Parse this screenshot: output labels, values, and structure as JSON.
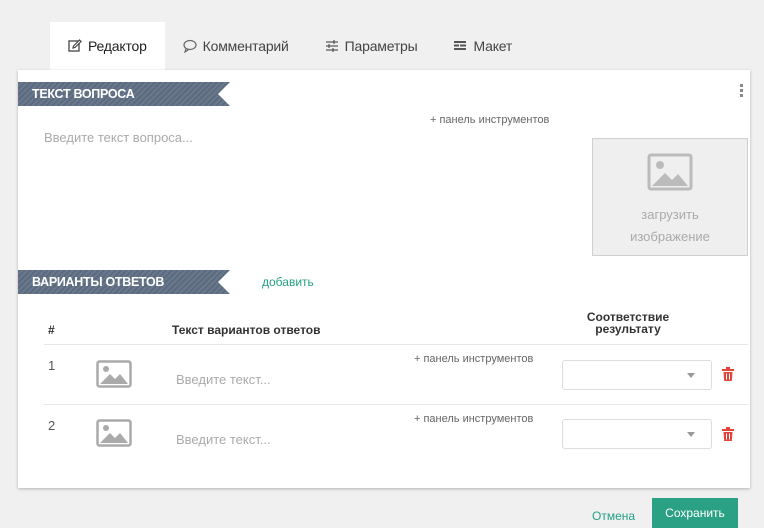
{
  "tabs": [
    {
      "label": "Редактор",
      "icon": "edit-icon",
      "active": true
    },
    {
      "label": "Комментарий",
      "icon": "comment-icon",
      "active": false
    },
    {
      "label": "Параметры",
      "icon": "sliders-icon",
      "active": false
    },
    {
      "label": "Макет",
      "icon": "layout-icon",
      "active": false
    }
  ],
  "question": {
    "section_title": "ТЕКСТ ВОПРОСА",
    "toolbar_link": "+ панель инструментов",
    "placeholder": "Введите текст вопроса...",
    "upload_line1": "загрузить",
    "upload_line2": "изображение"
  },
  "answers": {
    "section_title": "ВАРИАНТЫ ОТВЕТОВ",
    "add_link": "добавить",
    "col_num": "#",
    "col_text": "Текст вариантов ответов",
    "col_result_line1": "Соответствие",
    "col_result_line2": "результату",
    "rows": [
      {
        "num": "1",
        "placeholder": "Введите текст...",
        "toolbar_link": "+ панель инструментов"
      },
      {
        "num": "2",
        "placeholder": "Введите текст...",
        "toolbar_link": "+ панель инструментов"
      }
    ]
  },
  "footer": {
    "cancel": "Отмена",
    "save": "Сохранить"
  },
  "colors": {
    "accent": "#2aa184",
    "ribbon": "#5b6a7e",
    "delete": "#e0443a"
  }
}
